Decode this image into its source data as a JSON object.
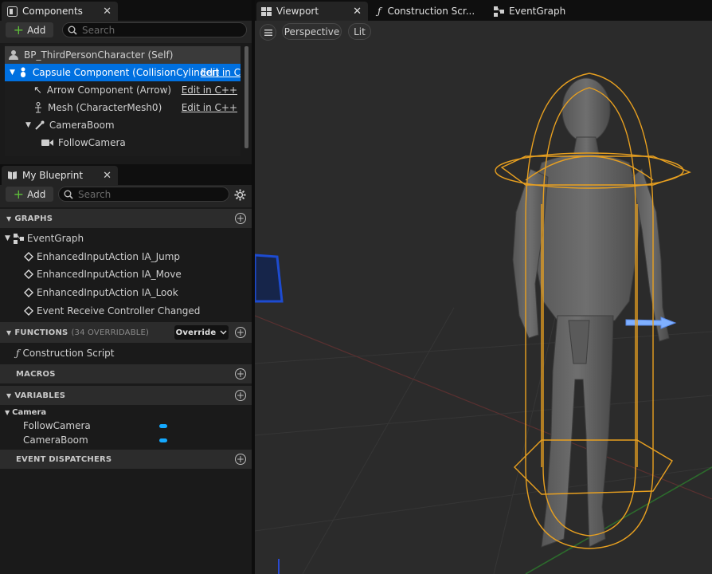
{
  "components_panel": {
    "tab_label": "Components",
    "add_label": "Add",
    "search_placeholder": "Search",
    "items": [
      {
        "label": "BP_ThirdPersonCharacter (Self)",
        "edit": ""
      },
      {
        "label": "Capsule Component (CollisionCylinder)",
        "edit": "Edit in C"
      },
      {
        "label": "Arrow Component (Arrow)",
        "edit": "Edit in C++"
      },
      {
        "label": "Mesh (CharacterMesh0)",
        "edit": "Edit in C++"
      },
      {
        "label": "CameraBoom",
        "edit": ""
      },
      {
        "label": "FollowCamera",
        "edit": ""
      }
    ]
  },
  "blueprint_panel": {
    "tab_label": "My Blueprint",
    "add_label": "Add",
    "search_placeholder": "Search",
    "graphs_header": "GRAPHS",
    "event_graph_label": "EventGraph",
    "graph_items": [
      "EnhancedInputAction IA_Jump",
      "EnhancedInputAction IA_Move",
      "EnhancedInputAction IA_Look",
      "Event Receive Controller Changed"
    ],
    "functions_header": "FUNCTIONS",
    "functions_note": "(34 OVERRIDABLE)",
    "override_label": "Override",
    "construction_script": "Construction Script",
    "macros_header": "MACROS",
    "variables_header": "VARIABLES",
    "variable_category": "Camera",
    "variables": [
      "FollowCamera",
      "CameraBoom"
    ],
    "dispatchers_header": "EVENT DISPATCHERS"
  },
  "viewport": {
    "tabs": [
      "Viewport",
      "Construction Scr...",
      "EventGraph"
    ],
    "perspective_label": "Perspective",
    "lit_label": "Lit"
  },
  "colors": {
    "selection": "#0070e0",
    "variable_pill": "#14a9ff",
    "collision": "#e8a020",
    "add_plus": "#5fbf3a"
  }
}
